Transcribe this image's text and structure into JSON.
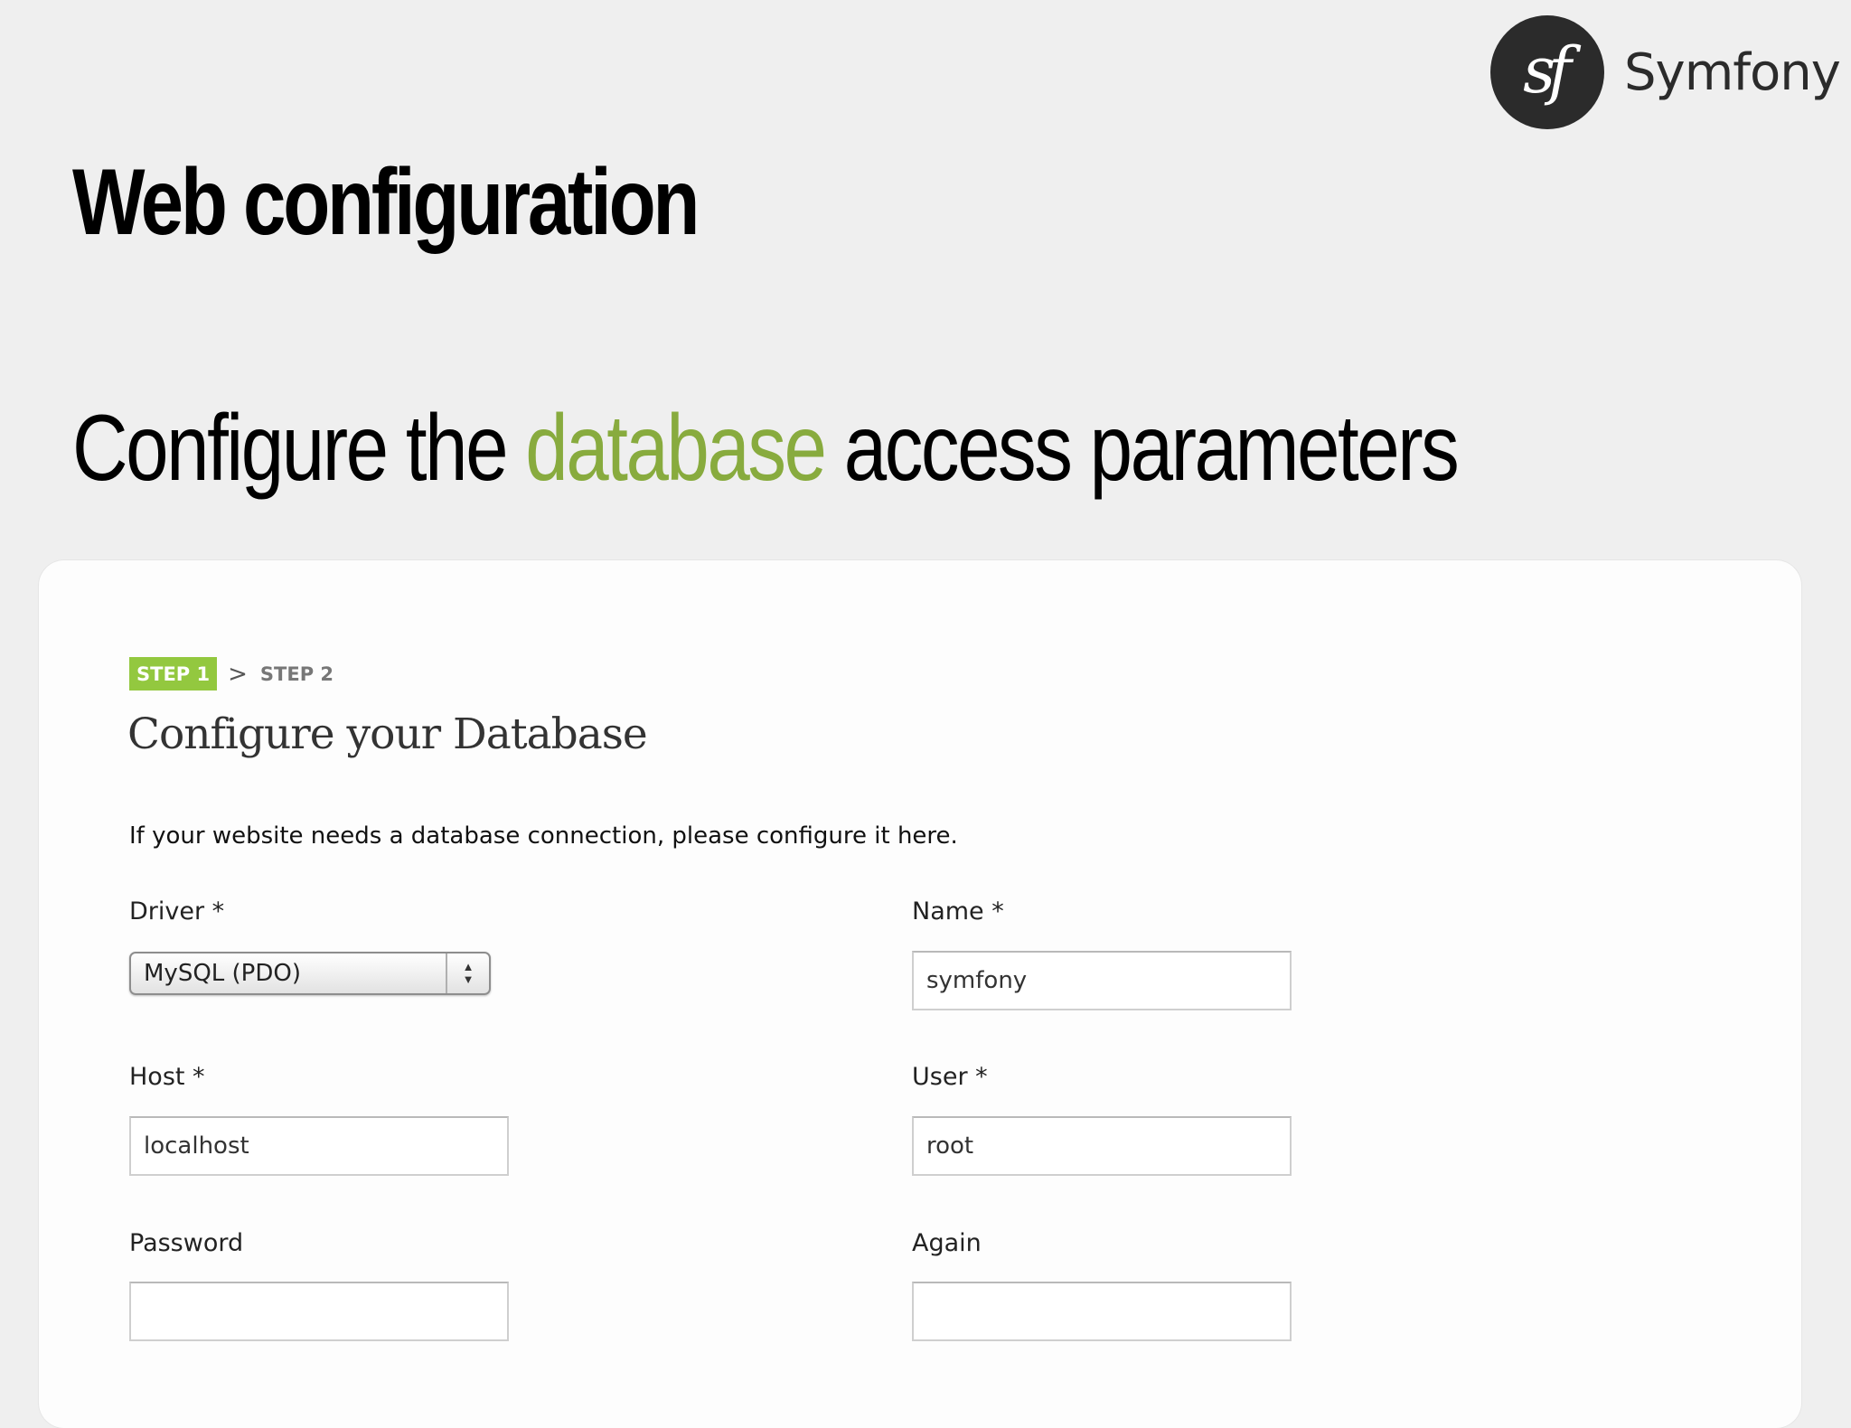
{
  "brand": {
    "logo_glyph": "sf",
    "name": "Symfony"
  },
  "slide": {
    "title": "Web configuration",
    "subtitle_before": "Configure the ",
    "subtitle_accent": "database",
    "subtitle_after": " access parameters",
    "accent_color": "#88ab3e"
  },
  "wizard": {
    "steps": {
      "active": "STEP 1",
      "separator": ">",
      "next": "STEP 2"
    },
    "title": "Configure your Database",
    "intro": "If your website needs a database connection, please configure it here.",
    "fields": {
      "driver": {
        "label": "Driver *",
        "value": "MySQL (PDO)"
      },
      "name": {
        "label": "Name *",
        "value": "symfony"
      },
      "host": {
        "label": "Host *",
        "value": "localhost"
      },
      "user": {
        "label": "User *",
        "value": "root"
      },
      "password": {
        "label": "Password",
        "value": ""
      },
      "again": {
        "label": "Again",
        "value": ""
      }
    },
    "step_color": "#93c83f"
  }
}
